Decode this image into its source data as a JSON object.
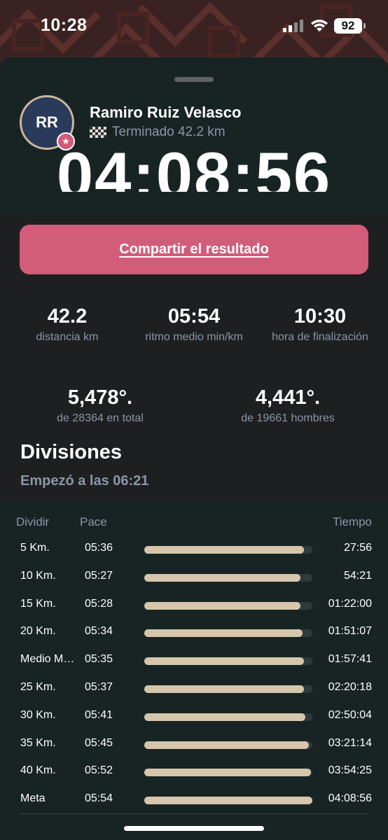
{
  "status_bar": {
    "time": "10:28",
    "battery": "92"
  },
  "runner": {
    "initials": "RR",
    "badge_icon": "star-icon",
    "name": "Ramiro Ruiz Velasco",
    "finish_flag_icon": "checkered-flag-icon",
    "finish_text": "Terminado 42.2 km",
    "finish_time": "04:08:56"
  },
  "share_label": "Compartir el resultado",
  "stats": [
    {
      "value": "42.2",
      "label": "distancia km"
    },
    {
      "value": "05:54",
      "label": "ritmo medio min/km"
    },
    {
      "value": "10:30",
      "label": "hora de finalización"
    }
  ],
  "ranks": [
    {
      "value": "5,478°.",
      "label": "de 28364 en total"
    },
    {
      "value": "4,441°.",
      "label": "de 19661 hombres"
    }
  ],
  "splits": {
    "title": "Divisiones",
    "start": "Empezó a las 06:21",
    "headers": {
      "split": "Dividir",
      "pace": "Pace",
      "time": "Tiempo"
    },
    "rows": [
      {
        "split": "5 Km.",
        "pace": "05:36",
        "time": "27:56",
        "progress": 0.95
      },
      {
        "split": "10 Km.",
        "pace": "05:27",
        "time": "54:21",
        "progress": 0.93
      },
      {
        "split": "15 Km.",
        "pace": "05:28",
        "time": "01:22:00",
        "progress": 0.93
      },
      {
        "split": "20 Km.",
        "pace": "05:34",
        "time": "01:51:07",
        "progress": 0.94
      },
      {
        "split": "Medio Maratón",
        "pace": "05:35",
        "time": "01:57:41",
        "progress": 0.95
      },
      {
        "split": "25 Km.",
        "pace": "05:37",
        "time": "02:20:18",
        "progress": 0.95
      },
      {
        "split": "30 Km.",
        "pace": "05:41",
        "time": "02:50:04",
        "progress": 0.96
      },
      {
        "split": "35 Km.",
        "pace": "05:45",
        "time": "03:21:14",
        "progress": 0.98
      },
      {
        "split": "40 Km.",
        "pace": "05:52",
        "time": "03:54:25",
        "progress": 0.99
      },
      {
        "split": "Meta",
        "pace": "05:54",
        "time": "04:08:56",
        "progress": 1.0
      }
    ]
  },
  "colors": {
    "accent": "#d15d7a",
    "bar": "#d6c6ac",
    "muted": "#8a96a8",
    "header_bg": "#182424"
  }
}
